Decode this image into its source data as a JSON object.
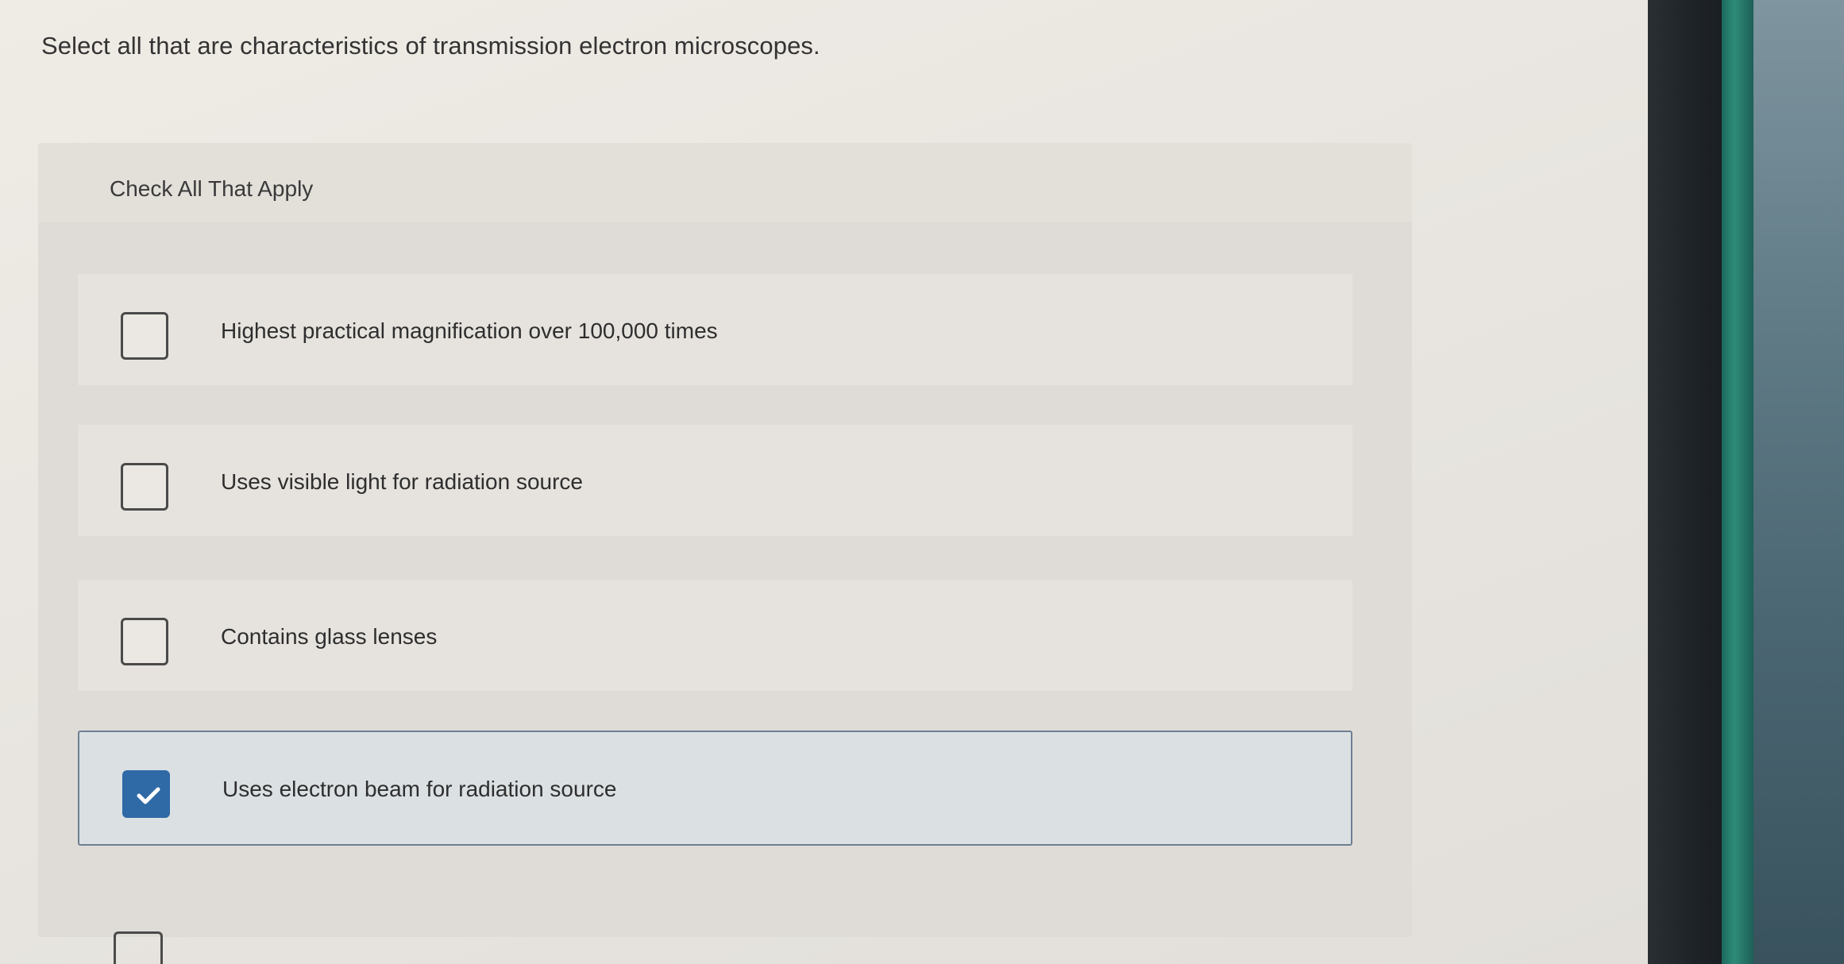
{
  "question": {
    "text": "Select all that are characteristics of transmission electron microscopes."
  },
  "panel": {
    "instruction": "Check All That Apply"
  },
  "options": [
    {
      "label": "Highest practical magnification over 100,000 times",
      "checked": false
    },
    {
      "label": "Uses visible light for radiation source",
      "checked": false
    },
    {
      "label": "Contains glass lenses",
      "checked": false
    },
    {
      "label": "Uses electron beam for radiation source",
      "checked": true
    }
  ],
  "colors": {
    "accent": "#2f69a6",
    "selected_border": "#6e7f93"
  },
  "icons": {
    "checked": "checkmark-icon"
  }
}
